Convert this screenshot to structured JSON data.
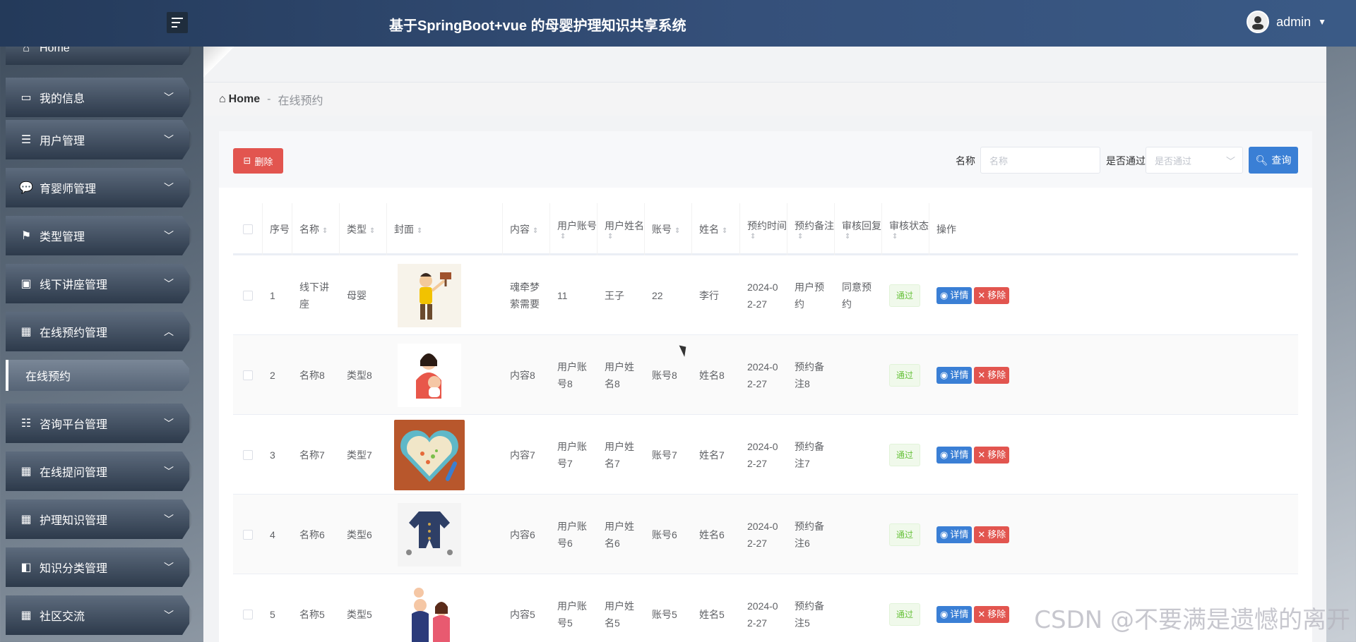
{
  "header": {
    "title": "基于SpringBoot+vue 的母婴护理知识共享系统",
    "user": "admin"
  },
  "sidebar": {
    "items": [
      {
        "label": "Home",
        "icon": "home-icon",
        "expandable": false
      },
      {
        "label": "我的信息",
        "icon": "card-icon",
        "expandable": true
      },
      {
        "label": "用户管理",
        "icon": "list-icon",
        "expandable": true
      },
      {
        "label": "育婴师管理",
        "icon": "chat-icon",
        "expandable": true
      },
      {
        "label": "类型管理",
        "icon": "flag-icon",
        "expandable": true
      },
      {
        "label": "线下讲座管理",
        "icon": "briefcase-icon",
        "expandable": true
      },
      {
        "label": "在线预约管理",
        "icon": "grid-icon",
        "expandable": true,
        "open": true
      },
      {
        "label": "咨询平台管理",
        "icon": "sliders-icon",
        "expandable": true
      },
      {
        "label": "在线提问管理",
        "icon": "grid-icon",
        "expandable": true
      },
      {
        "label": "护理知识管理",
        "icon": "grid-icon",
        "expandable": true
      },
      {
        "label": "知识分类管理",
        "icon": "wallet-icon",
        "expandable": true
      },
      {
        "label": "社区交流",
        "icon": "grid-icon",
        "expandable": true
      }
    ],
    "active_sub": "在线预约"
  },
  "breadcrumb": {
    "home": "Home",
    "separator": "-",
    "current": "在线预约"
  },
  "toolbar": {
    "delete_label": "删除",
    "name_label": "名称",
    "name_placeholder": "名称",
    "pass_label": "是否通过",
    "pass_placeholder": "是否通过",
    "query_label": "查询"
  },
  "table": {
    "columns": [
      "序号",
      "名称",
      "类型",
      "封面",
      "内容",
      "用户账号",
      "用户姓名",
      "账号",
      "姓名",
      "预约时间",
      "预约备注",
      "审核回复",
      "审核状态",
      "操作"
    ],
    "rows": [
      {
        "no": "1",
        "name": "线下讲座",
        "type": "母婴",
        "cover": "cover-person-sign",
        "content": "魂牵梦萦需要",
        "user_account": "11",
        "user_name": "王子",
        "account": "22",
        "real_name": "李行",
        "time": "2024-02-27",
        "remark": "用户预约",
        "reply": "同意预约",
        "status": "通过"
      },
      {
        "no": "2",
        "name": "名称8",
        "type": "类型8",
        "cover": "cover-mother-baby",
        "content": "内容8",
        "user_account": "用户账号8",
        "user_name": "用户姓名8",
        "account": "账号8",
        "real_name": "姓名8",
        "time": "2024-02-27",
        "remark": "预约备注8",
        "reply": "",
        "status": "通过"
      },
      {
        "no": "3",
        "name": "名称7",
        "type": "类型7",
        "cover": "cover-heart-bowl",
        "content": "内容7",
        "user_account": "用户账号7",
        "user_name": "用户姓名7",
        "account": "账号7",
        "real_name": "姓名7",
        "time": "2024-02-27",
        "remark": "预约备注7",
        "reply": "",
        "status": "通过"
      },
      {
        "no": "4",
        "name": "名称6",
        "type": "类型6",
        "cover": "cover-baby-romper",
        "content": "内容6",
        "user_account": "用户账号6",
        "user_name": "用户姓名6",
        "account": "账号6",
        "real_name": "姓名6",
        "time": "2024-02-27",
        "remark": "预约备注6",
        "reply": "",
        "status": "通过"
      },
      {
        "no": "5",
        "name": "名称5",
        "type": "类型5",
        "cover": "cover-family",
        "content": "内容5",
        "user_account": "用户账号5",
        "user_name": "用户姓名5",
        "account": "账号5",
        "real_name": "姓名5",
        "time": "2024-02-27",
        "remark": "预约备注5",
        "reply": "",
        "status": "通过"
      }
    ],
    "op_detail": "详情",
    "op_remove": "移除"
  },
  "watermark": "CSDN @不要满是遗憾的离开",
  "colors": {
    "danger": "#e2554f",
    "primary": "#3a7fd5",
    "success": "#67c23a"
  }
}
